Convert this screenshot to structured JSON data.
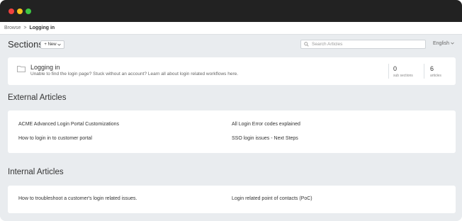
{
  "breadcrumb": {
    "root": "Browse",
    "separator": ">",
    "current": "Logging in"
  },
  "sections": {
    "title": "Sections",
    "new_button": "+ New",
    "search_placeholder": "Search Articles",
    "language": "English"
  },
  "section": {
    "name": "Logging in",
    "description": "Unable to find the login page? Stuck without an account? Learn all about login related workflows here.",
    "sub_sections": {
      "count": "0",
      "label": "sub sections"
    },
    "articles": {
      "count": "6",
      "label": "articles"
    }
  },
  "external": {
    "heading": "External Articles",
    "items": [
      "ACME Advanced Login Portal Customizations",
      "All Login Error codes explained",
      "How to login in to customer portal",
      "SSO login issues - Next Steps"
    ]
  },
  "internal": {
    "heading": "Internal Articles",
    "items": [
      "How to troubleshoot a customer's login related issues.",
      "Login related point of contacts (PoC)"
    ]
  }
}
